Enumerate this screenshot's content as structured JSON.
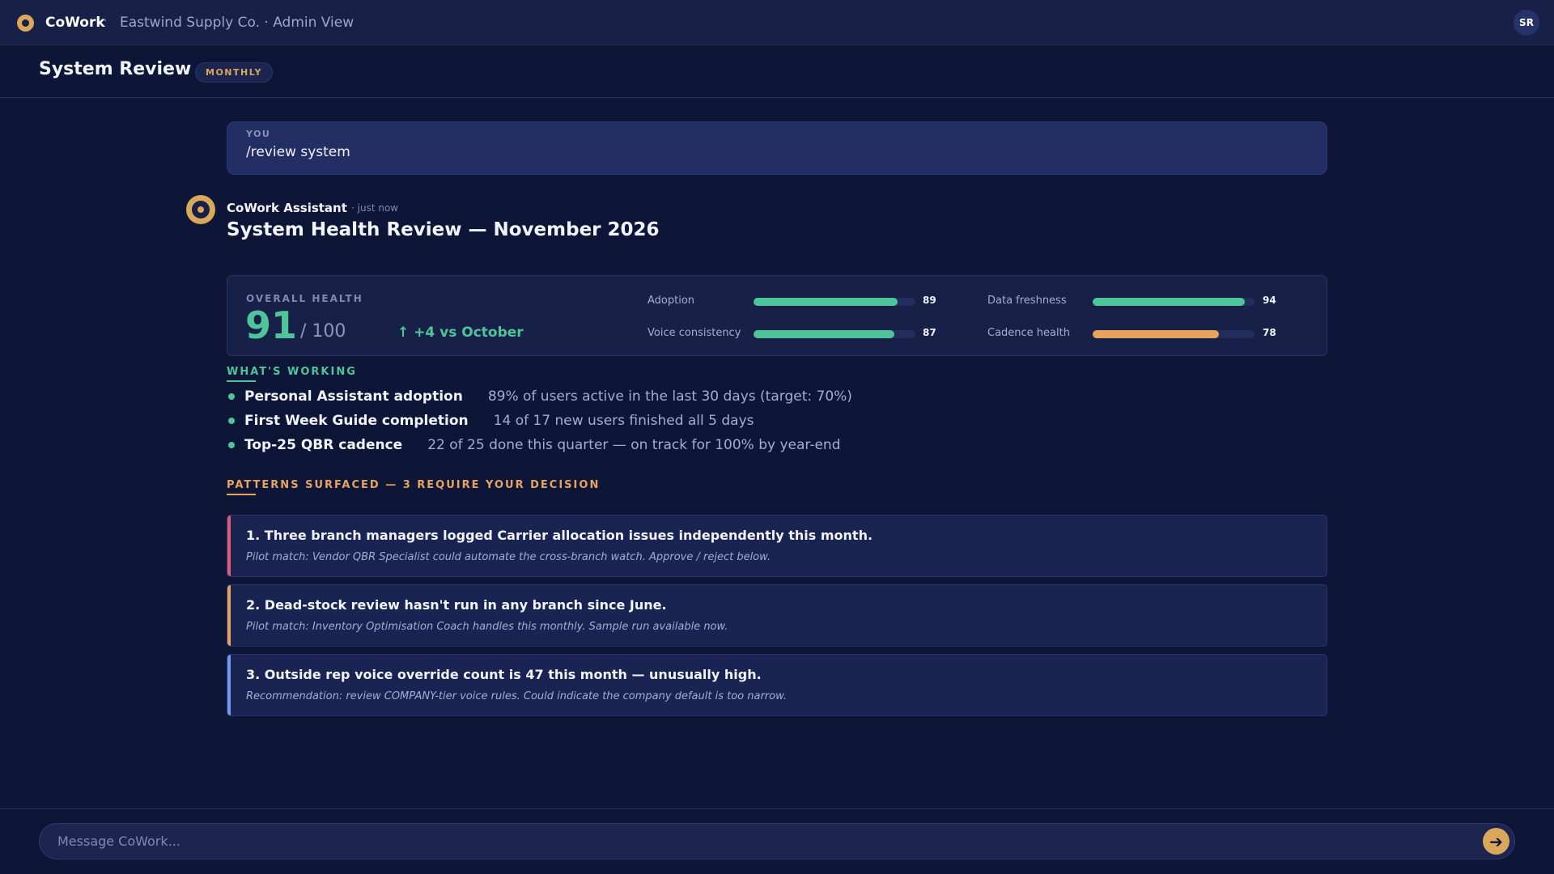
{
  "topbar": {
    "brand": "CoWork",
    "separator": "·",
    "org": "Eastwind Supply Co. · Admin View",
    "avatar_initials": "SR"
  },
  "page": {
    "title": "System Review",
    "badge": "MONTHLY"
  },
  "user_message": {
    "label": "YOU",
    "text": "/review system"
  },
  "assistant": {
    "name": "CoWork Assistant",
    "time": "· just now",
    "title": "System Health Review — November 2026"
  },
  "health": {
    "label": "OVERALL HEALTH",
    "score": "91",
    "score_max": "/ 100",
    "delta": "↑ +4 vs October",
    "metrics": [
      {
        "label": "Adoption",
        "value": 89,
        "value_text": "89",
        "color": "#4fc49a"
      },
      {
        "label": "Voice consistency",
        "value": 87,
        "value_text": "87",
        "color": "#4fc49a"
      },
      {
        "label": "Data freshness",
        "value": 94,
        "value_text": "94",
        "color": "#4fc49a"
      },
      {
        "label": "Cadence health",
        "value": 78,
        "value_text": "78",
        "color": "#e8a35c"
      }
    ]
  },
  "working": {
    "label": "WHAT'S WORKING",
    "items": [
      {
        "title": "Personal Assistant adoption",
        "desc": "89% of users active in the last 30 days (target: 70%)"
      },
      {
        "title": "First Week Guide completion",
        "desc": "14 of 17 new users finished all 5 days"
      },
      {
        "title": "Top-25 QBR cadence",
        "desc": "22 of 25 done this quarter — on track for 100% by year-end"
      }
    ]
  },
  "patterns": {
    "label": "PATTERNS SURFACED — 3 REQUIRE YOUR DECISION",
    "items": [
      {
        "title": "1. Three branch managers logged Carrier allocation issues independently this month.",
        "sub": "Pilot match: Vendor QBR Specialist could automate the cross-branch watch. Approve / reject below.",
        "color": "#e05a7a"
      },
      {
        "title": "2. Dead-stock review hasn't run in any branch since June.",
        "sub": "Pilot match: Inventory Optimisation Coach handles this monthly. Sample run available now.",
        "color": "#e8a35c"
      },
      {
        "title": "3. Outside rep voice override count is 47 this month — unusually high.",
        "sub": "Recommendation: review COMPANY-tier voice rules. Could indicate the company default is too narrow.",
        "color": "#6f9cf0"
      }
    ]
  },
  "composer": {
    "placeholder": "Message CoWork...",
    "send_icon": "arrow-right-icon"
  },
  "colors": {
    "accent": "#d9a85a",
    "good": "#4fc49a",
    "warning": "#e8a35c",
    "background": "#0e1638"
  }
}
